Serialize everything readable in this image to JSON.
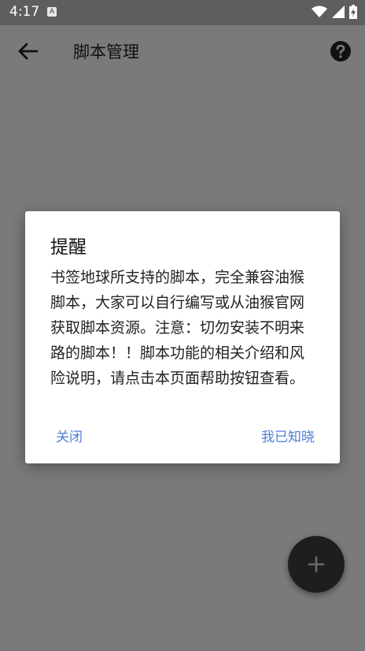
{
  "status_bar": {
    "time": "4:17",
    "notification_glyph": "A",
    "icons": [
      "wifi-icon",
      "signal-icon",
      "battery-charging-icon"
    ]
  },
  "app_bar": {
    "title": "脚本管理",
    "back_icon": "arrow-left-icon",
    "help_icon": "help-circle-icon"
  },
  "dialog": {
    "title": "提醒",
    "message": "书签地球所支持的脚本，完全兼容油猴脚本，大家可以自行编写或从油猴官网获取脚本资源。注意：切勿安装不明来路的脚本！！脚本功能的相关介绍和风险说明，请点击本页面帮助按钮查看。",
    "close_label": "关闭",
    "ok_label": "我已知晓"
  },
  "fab": {
    "icon": "plus-icon"
  },
  "colors": {
    "accent": "#4f7fd6",
    "fab": "#1e1e1e",
    "scrim": "#7a7a7a"
  }
}
